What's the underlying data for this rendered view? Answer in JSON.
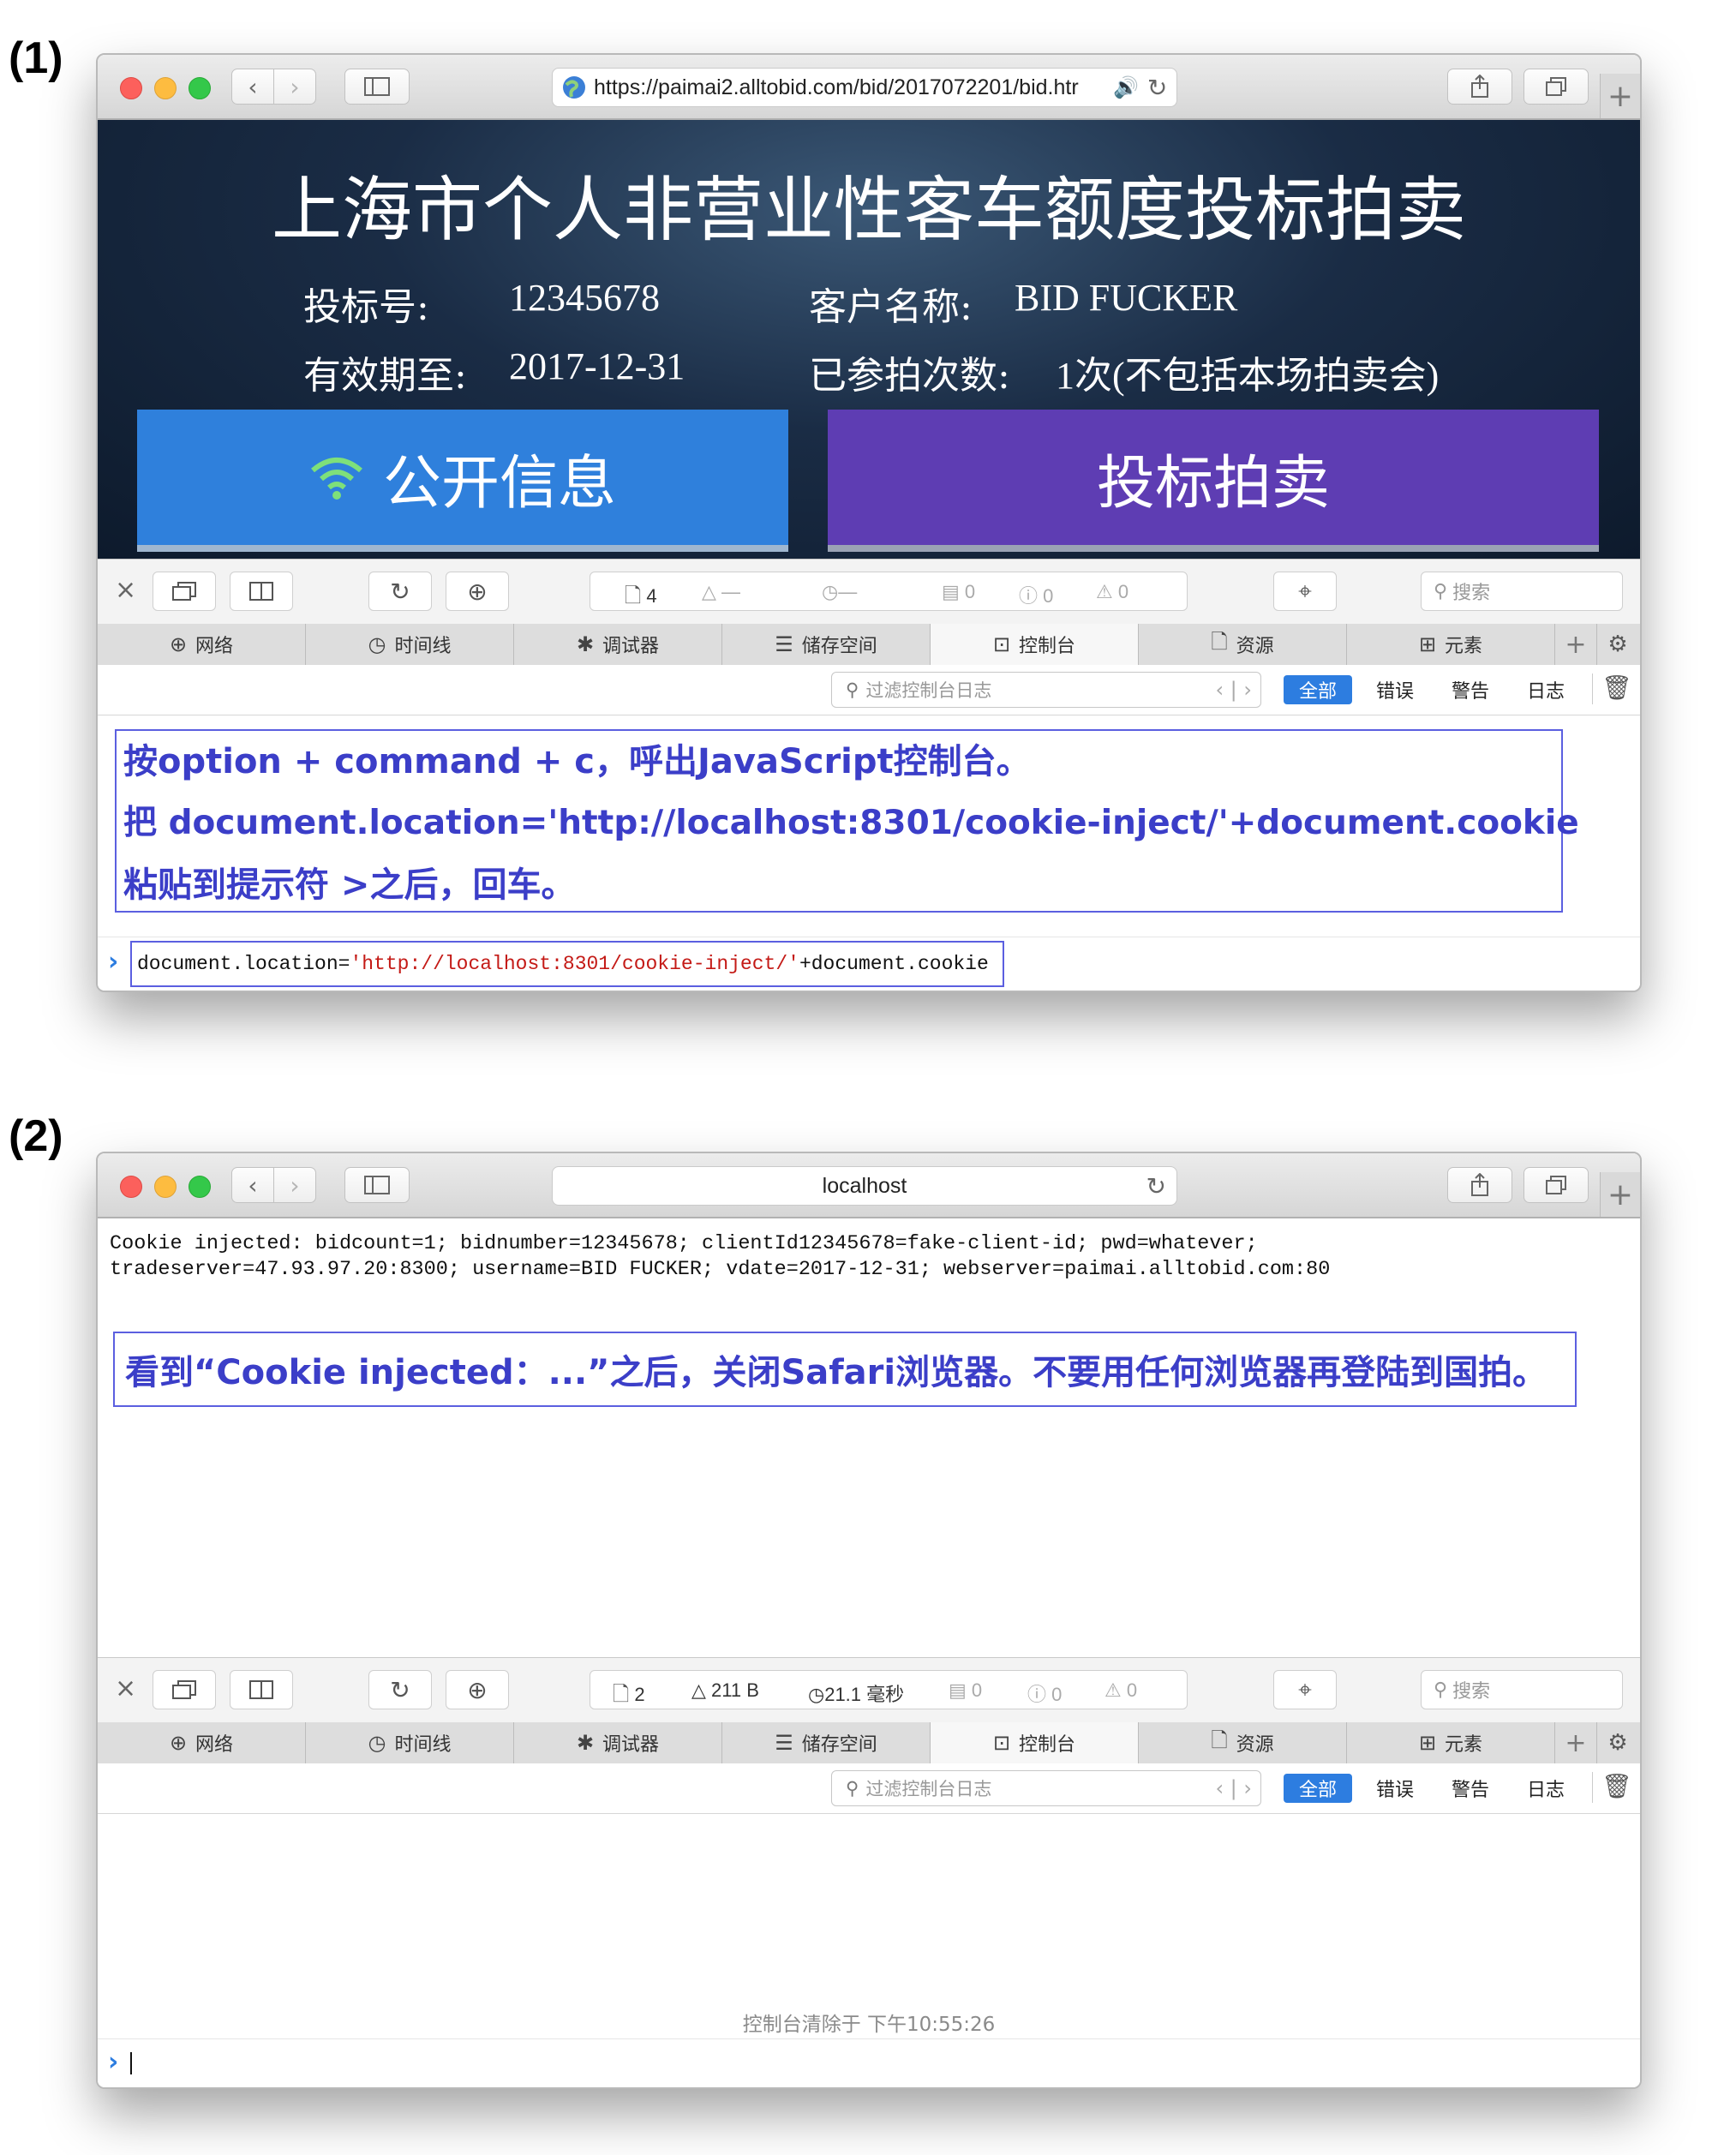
{
  "step1": {
    "label": "(1)",
    "url": "https://paimai2.alltobid.com/bid/2017072201/bid.htr",
    "page": {
      "title": "上海市个人非营业性客车额度投标拍卖",
      "bid_number_label": "投标号:",
      "bid_number_value": "12345678",
      "customer_label": "客户名称:",
      "customer_value": "BID FUCKER",
      "valid_until_label": "有效期至:",
      "valid_until_value": "2017-12-31",
      "attempts_label": "已参拍次数:",
      "attempts_value": "1次(不包括本场拍卖会)",
      "public_info_button": "公开信息",
      "bid_button": "投标拍卖"
    },
    "devtools": {
      "status": {
        "resources": "4",
        "size": "—",
        "time": "—",
        "logs": "0",
        "errors": "0",
        "warnings": "0"
      },
      "search_placeholder": "搜索",
      "filter_placeholder": "过滤控制台日志",
      "annotation_lines": [
        "按option + command + c，呼出JavaScript控制台。",
        "把 document.location='http://localhost:8301/cookie-inject/'+document.cookie",
        "粘贴到提示符 >之后，回车。"
      ],
      "console_input": {
        "prefix": "document.location=",
        "string": "'http://localhost:8301/cookie-inject/'",
        "suffix": "+document.cookie"
      }
    }
  },
  "step2": {
    "label": "(2)",
    "url": "localhost",
    "page": {
      "line1": "Cookie injected: bidcount=1; bidnumber=12345678; clientId12345678=fake-client-id; pwd=whatever;",
      "line2": "tradeserver=47.93.97.20:8300; username=BID FUCKER; vdate=2017-12-31; webserver=paimai.alltobid.com:80",
      "annotation": "看到“Cookie injected：...”之后，关闭Safari浏览器。不要用任何浏览器再登陆到国拍。"
    },
    "devtools": {
      "status": {
        "resources": "2",
        "size": "211 B",
        "time": "21.1 毫秒",
        "logs": "0",
        "errors": "0",
        "warnings": "0"
      },
      "search_placeholder": "搜索",
      "filter_placeholder": "过滤控制台日志",
      "cleared_message": "控制台清除于 下午10:55:26"
    }
  },
  "devtools_tabs": [
    "网络",
    "时间线",
    "调试器",
    "储存空间",
    "控制台",
    "资源",
    "元素"
  ],
  "console_levels": [
    "全部",
    "错误",
    "警告",
    "日志"
  ],
  "colors": {
    "page_dark": "#13233a",
    "public_info_blue": "#2f80dc",
    "bid_purple": "#5e3db3",
    "annotation_blue": "#3b3ec8",
    "active_level": "#2d7de0"
  }
}
